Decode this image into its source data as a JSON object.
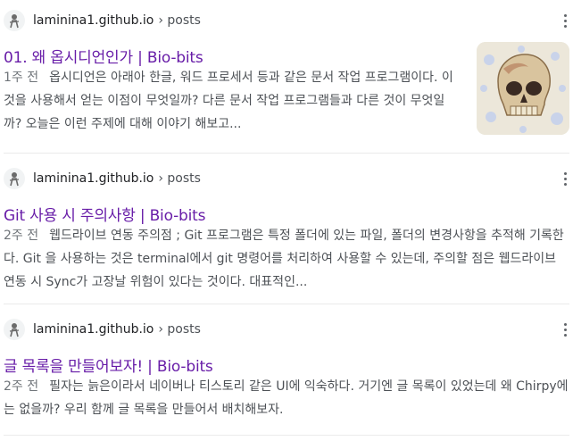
{
  "results": [
    {
      "site": "laminina1.github.io",
      "path": "› posts",
      "title": "01. 왜 옵시디언인가 | Bio-bits",
      "date": "1주 전",
      "snippet": "옵시디언은 아래아 한글, 워드 프로세서 등과 같은 문서 작업 프로그램이다. 이것을 사용해서 얻는 이점이 무엇일까? 다른 문서 작업 프로그램들과 다른 것이 무엇일까? 오늘은 이런 주제에 대해 이야기 해보고...",
      "thumbnail_icon": "skull-icon"
    },
    {
      "site": "laminina1.github.io",
      "path": "› posts",
      "title": "Git 사용 시 주의사항 | Bio-bits",
      "date": "2주 전",
      "snippet": "웹드라이브 연동 주의점 ; Git 프로그램은 특정 폴더에 있는 파일, 폴더의 변경사항을 추적해 기록한다. Git 을 사용하는 것은 terminal에서 git 명령어를 처리하여 사용할 수 있는데, 주의할 점은 웹드라이브 연동 시 Sync가 고장날 위험이 있다는 것이다. 대표적인..."
    },
    {
      "site": "laminina1.github.io",
      "path": "› posts",
      "title": "글 목록을 만들어보자! | Bio-bits",
      "date": "2주 전",
      "snippet": "필자는 늙은이라서 네이버나 티스토리 같은 UI에 익숙하다. 거기엔 글 목록이 있었는데 왜 Chirpy에는 없을까? 우리 함께 글 목록을 만들어서 배치해보자."
    }
  ],
  "colors": {
    "title": "#681da8",
    "snippet": "#4d5156",
    "date": "#70757a",
    "site": "#202124"
  }
}
